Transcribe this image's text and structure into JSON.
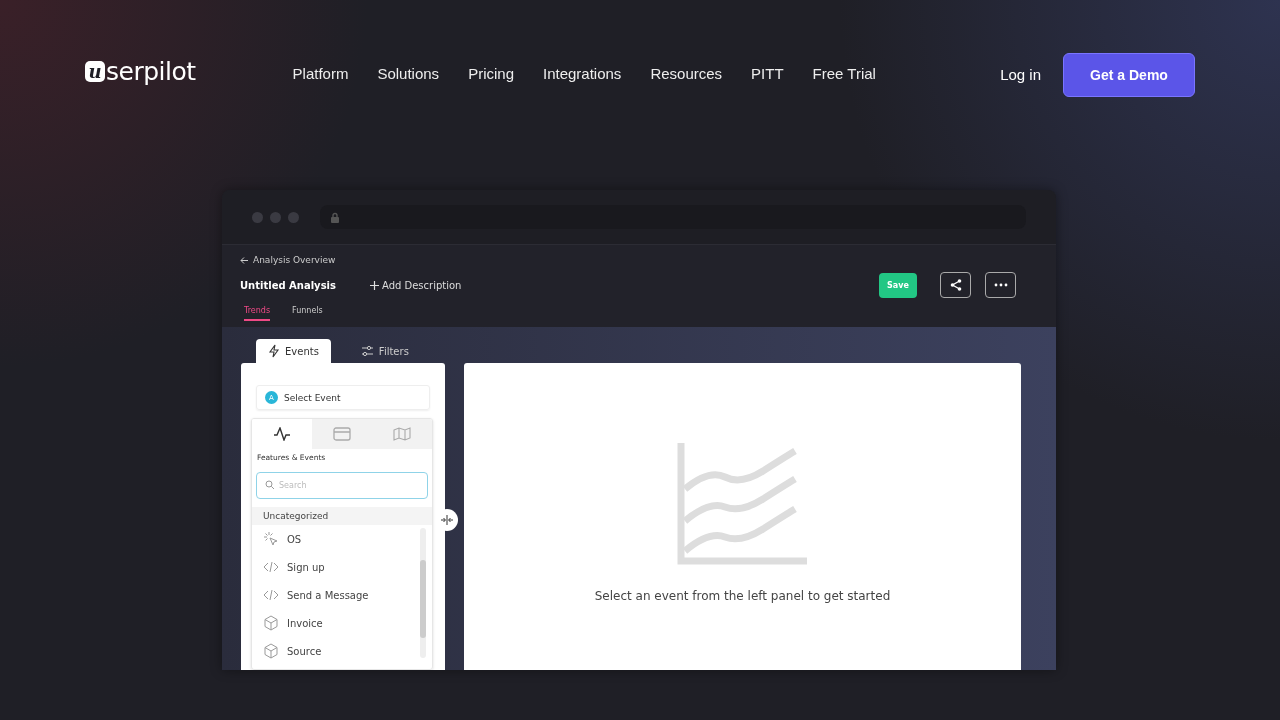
{
  "logo": {
    "mark": "u",
    "text": "serpilot"
  },
  "nav": [
    "Platform",
    "Solutions",
    "Pricing",
    "Integrations",
    "Resources",
    "PITT",
    "Free Trial"
  ],
  "login": "Log in",
  "demo_button": "Get a Demo",
  "app": {
    "back_link": "Analysis Overview",
    "title": "Untitled Analysis",
    "add_description": "Add Description",
    "save": "Save",
    "tabs": [
      {
        "label": "Trends",
        "selected": true
      },
      {
        "label": "Funnels",
        "selected": false
      }
    ],
    "panel_tabs": [
      {
        "label": "Events",
        "selected": true
      },
      {
        "label": "Filters",
        "selected": false
      }
    ],
    "event_badge": "A",
    "select_event": "Select Event",
    "category_tabs": [
      {
        "kind": "pulse",
        "selected": true
      },
      {
        "kind": "window",
        "selected": false
      },
      {
        "kind": "map",
        "selected": false
      }
    ],
    "section_title": "Features & Events",
    "search": {
      "placeholder": "Search"
    },
    "group": "Uncategorized",
    "events": [
      {
        "kind": "click",
        "label": "OS"
      },
      {
        "kind": "code",
        "label": "Sign up"
      },
      {
        "kind": "code",
        "label": "Send a Message"
      },
      {
        "kind": "cube",
        "label": "Invoice"
      },
      {
        "kind": "cube",
        "label": "Source"
      }
    ],
    "empty_message": "Select an event from the left panel to get started"
  }
}
